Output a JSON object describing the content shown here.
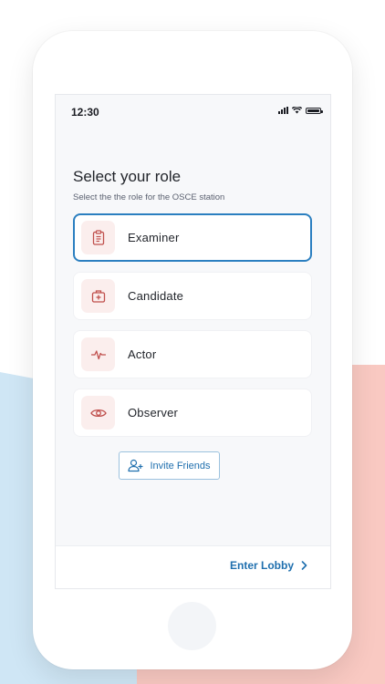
{
  "status_bar": {
    "time": "12:30"
  },
  "header": {
    "title": "Select your role",
    "subtitle": "Select the the role for the OSCE station"
  },
  "roles": [
    {
      "label": "Examiner",
      "icon": "clipboard-icon",
      "selected": true
    },
    {
      "label": "Candidate",
      "icon": "medical-bag-icon",
      "selected": false
    },
    {
      "label": "Actor",
      "icon": "pulse-icon",
      "selected": false
    },
    {
      "label": "Observer",
      "icon": "eye-icon",
      "selected": false
    }
  ],
  "invite_button": {
    "label": "Invite Friends",
    "icon": "add-user-icon"
  },
  "footer": {
    "enter_lobby_label": "Enter Lobby",
    "icon": "chevron-right-icon"
  },
  "colors": {
    "accent": "#2b7fc0",
    "icon_red": "#c0504d",
    "icon_bg": "#fbeeed",
    "bg_blue": "#cfe6f5",
    "bg_pink": "#f9c9c2"
  }
}
